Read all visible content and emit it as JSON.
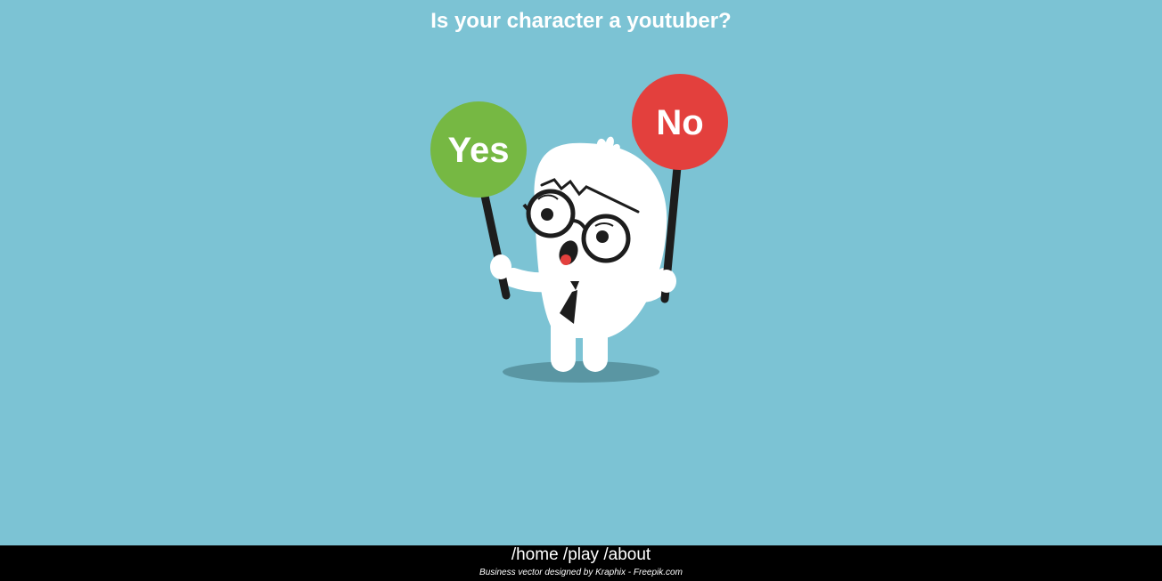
{
  "question": "Is your character a youtuber?",
  "answers": {
    "yes_label": "Yes",
    "no_label": "No"
  },
  "colors": {
    "background": "#7cc3d4",
    "yes": "#76b843",
    "no": "#e3403d",
    "footer": "#000000"
  },
  "nav": {
    "home": "/home",
    "play": "/play",
    "about": "/about"
  },
  "credit": "Business vector designed by Kraphix - Freepik.com"
}
